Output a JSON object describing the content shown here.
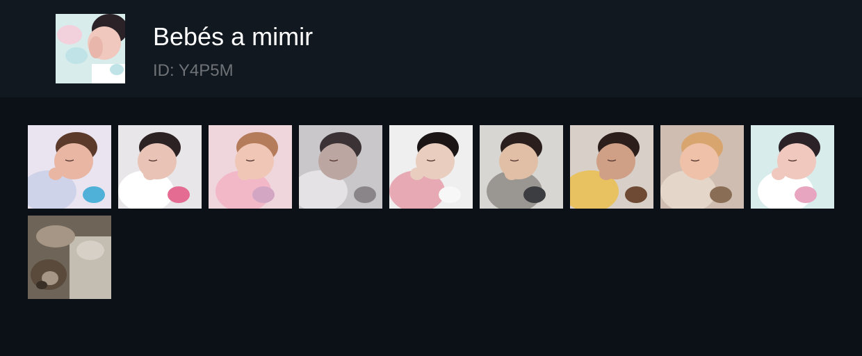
{
  "album": {
    "title": "Bebés a mimir",
    "id_label": "ID: Y4P5M"
  },
  "photos": [
    {
      "subject": "baby sleeping on colorful blanket",
      "bg": "#e9e4ef",
      "skin": "#e8b6a3",
      "hair": "#5b3a2c",
      "cloth": "#cfd3ea",
      "accent": "#4fb0d8"
    },
    {
      "subject": "baby sleeping with pink hair clip",
      "bg": "#e8e6e8",
      "skin": "#e8c3b6",
      "hair": "#2c2224",
      "cloth": "#ffffff",
      "accent": "#e46c92"
    },
    {
      "subject": "baby sleeping with bow",
      "bg": "#efd6dc",
      "skin": "#f0c7b6",
      "hair": "#b57c5c",
      "cloth": "#f2b8c8",
      "accent": "#d3a7c4"
    },
    {
      "subject": "baby sleeping in grey bed",
      "bg": "#c9c7ca",
      "skin": "#bca6a1",
      "hair": "#3a3235",
      "cloth": "#e4e2e5",
      "accent": "#8a8589"
    },
    {
      "subject": "toddler hugging white bunny",
      "bg": "#efefef",
      "skin": "#e9cdbf",
      "hair": "#1b1516",
      "cloth": "#e7a9b4",
      "accent": "#f7f7f7"
    },
    {
      "subject": "toddler sleeping with grey toy",
      "bg": "#d8d6d2",
      "skin": "#e0bfa6",
      "hair": "#2a1f1d",
      "cloth": "#9a9793",
      "accent": "#3c3d40"
    },
    {
      "subject": "baby hugging teddy bear",
      "bg": "#d8cfc8",
      "skin": "#cf9f86",
      "hair": "#2b1e1b",
      "cloth": "#e8c160",
      "accent": "#6e4a34"
    },
    {
      "subject": "baby sleeping on fluffy pillow",
      "bg": "#cfbdb2",
      "skin": "#efc1a8",
      "hair": "#d9a56f",
      "cloth": "#e4d7c9",
      "accent": "#8a6d55"
    },
    {
      "subject": "baby sleeping with hand on face",
      "bg": "#d8ecec",
      "skin": "#f0c8be",
      "hair": "#2a2226",
      "cloth": "#ffffff",
      "accent": "#e7a5bf"
    },
    {
      "subject": "plush lion toy on blanket",
      "bg": "#6e6458",
      "skin": "#a59685",
      "hair": "#5a4a3c",
      "cloth": "#c4bdb1",
      "accent": "#3a2f27"
    }
  ]
}
